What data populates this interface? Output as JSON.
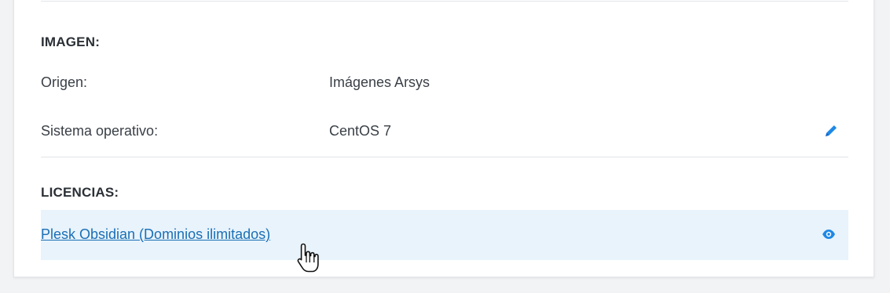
{
  "imagen": {
    "title": "IMAGEN:",
    "rows": [
      {
        "label": "Origen:",
        "value": "Imágenes Arsys"
      },
      {
        "label": "Sistema operativo:",
        "value": "CentOS 7"
      }
    ],
    "edit_icon": "pencil-icon"
  },
  "licencias": {
    "title": "LICENCIAS:",
    "items": [
      {
        "label": "Plesk Obsidian (Dominios ilimitados)",
        "icon": "eye-icon"
      }
    ]
  },
  "colors": {
    "accent": "#1e88e5",
    "link": "#1a6fb5",
    "row_highlight": "#e8f3fc"
  }
}
